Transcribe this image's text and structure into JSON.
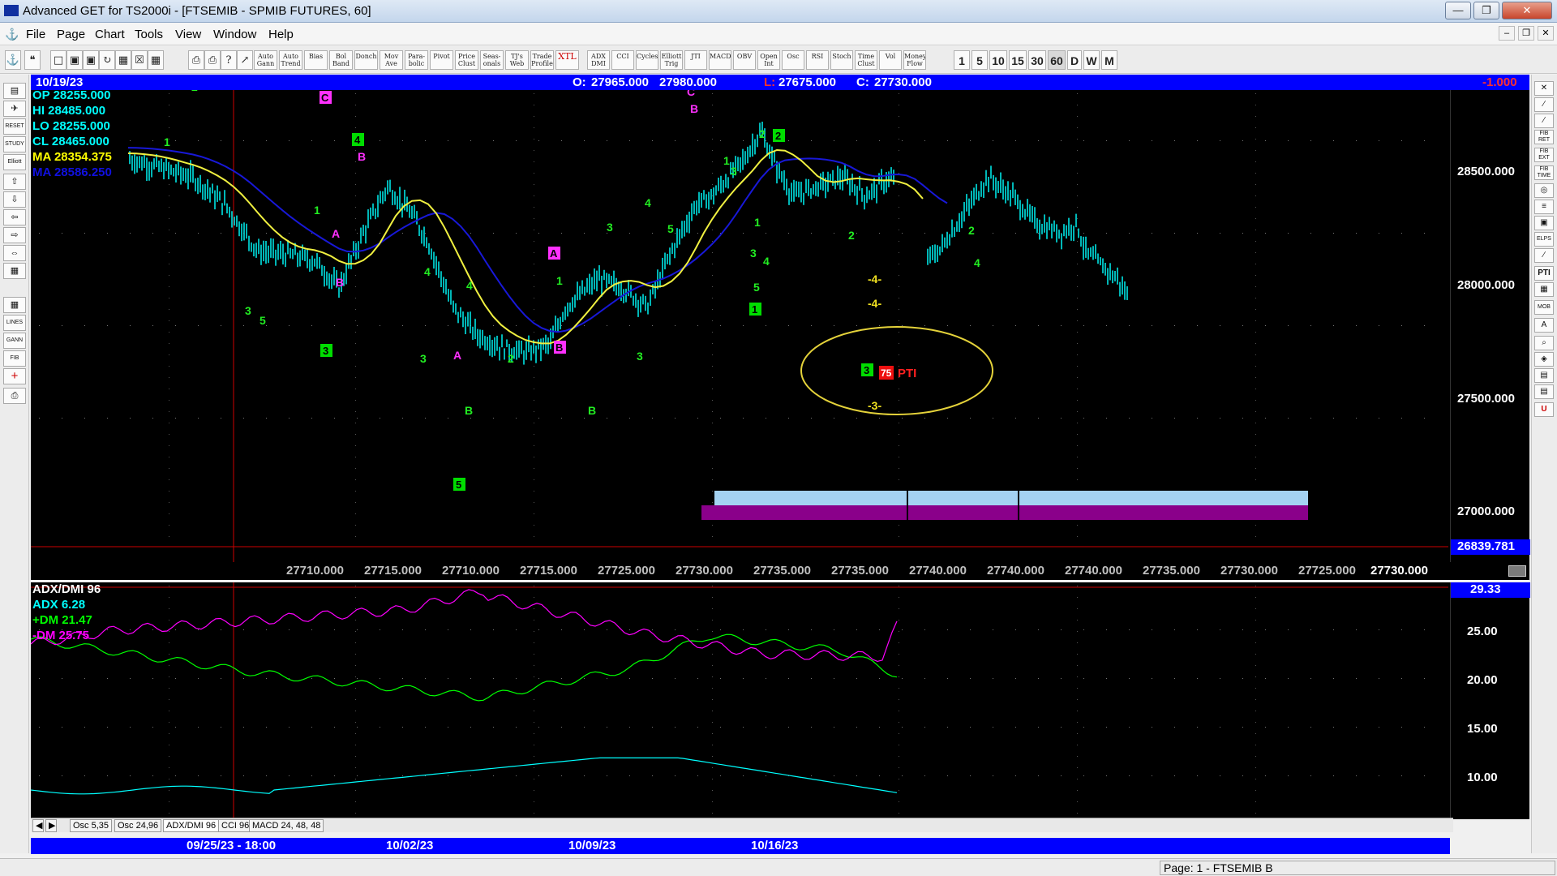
{
  "window": {
    "title": "Advanced GET for TS2000i - [FTSEMIB - SPMIB FUTURES, 60]",
    "min_glyph": "—",
    "max_glyph": "❐",
    "close_glyph": "✕"
  },
  "menu": {
    "items": [
      "File",
      "Page",
      "Chart",
      "Tools",
      "View",
      "Window",
      "Help"
    ],
    "mdi": [
      "–",
      "❐",
      "✕"
    ]
  },
  "toolbar": {
    "icons": [
      "⚓",
      "❝",
      "□",
      "▣",
      "▣",
      "↻",
      "▦",
      "☒",
      "▦",
      "⎙",
      "⎙",
      "?",
      "↗"
    ],
    "study_buttons": [
      "Auto Gann",
      "Auto Trend",
      "Bias",
      "Bol Band",
      "Donch",
      "Mov Ave",
      "Para-bolic",
      "Pivot",
      "Price Clust",
      "Seas-onals",
      "TJ's Web",
      "Trade Profile",
      "XTL",
      "ADX DMI",
      "CCI",
      "Cycles",
      "Elliott Trig",
      "JTI",
      "MACD",
      "OBV",
      "Open Int",
      "Osc",
      "RSI",
      "Stoch",
      "Time Clust",
      "Vol",
      "Money Flow"
    ],
    "periods": [
      "1",
      "5",
      "10",
      "15",
      "30",
      "60",
      "D",
      "W",
      "M"
    ],
    "active_period": "60"
  },
  "left_tools": [
    "▤",
    "✈",
    "RESET",
    "STUDY",
    "Elliott",
    "⇧",
    "⇩",
    "⇦",
    "⇨",
    "⇔",
    "▦",
    "▦",
    "LINES",
    "GANN",
    "FIB",
    "+",
    "⎙"
  ],
  "right_tools": [
    "✕",
    "∕",
    "∕",
    "FIB RET",
    "FIB EXT",
    "FIB TIME",
    "◎",
    "≡",
    "▣",
    "ELPS",
    "∕",
    "PTI",
    "▦",
    "MOB",
    "A",
    "⌕",
    "◈",
    "▤",
    "▤",
    "U"
  ],
  "chart_header": {
    "date": "10/19/23",
    "open_label": "O:",
    "open": "27965.000",
    "high": "27980.000",
    "low_label": "L:",
    "low": "27675.000",
    "close_label": "C:",
    "close": "27730.000",
    "change": "-1.000"
  },
  "legend": [
    {
      "text": "OP  28255.000",
      "color": "#00ffff"
    },
    {
      "text": "HI   28485.000",
      "color": "#00ffff"
    },
    {
      "text": "LO  28255.000",
      "color": "#00ffff"
    },
    {
      "text": "CL   28465.000",
      "color": "#00ffff"
    },
    {
      "text": "MA  28354.375",
      "color": "#ffff00"
    },
    {
      "text": "MA  28586.250",
      "color": "#1010e0"
    }
  ],
  "price_axis": {
    "labels": [
      "28500.000",
      "28000.000",
      "27500.000",
      "27000.000"
    ],
    "line_label": "26839.781"
  },
  "pivot_row": {
    "values": [
      "27710.000",
      "27715.000",
      "27710.000",
      "27715.000",
      "27725.000",
      "27730.000",
      "27735.000",
      "27735.000",
      "27740.000",
      "27740.000",
      "27740.000",
      "27735.000",
      "27730.000",
      "27725.000"
    ],
    "last": "27730.000"
  },
  "wave_labels": {
    "numbers": [
      "1",
      "2",
      "1",
      "4",
      "3",
      "5",
      "3",
      "4",
      "2",
      "1",
      "3",
      "4",
      "3",
      "5",
      "1",
      "2",
      "3",
      "4",
      "2",
      "1",
      "3",
      "5",
      "4",
      "2"
    ],
    "letters": [
      "A",
      "B",
      "B",
      "A",
      "B",
      "B",
      "C",
      "B"
    ],
    "boxed": [
      "4",
      "3",
      "5",
      "2",
      "1",
      "3"
    ],
    "pti_number": "75",
    "pti_text": "PTI",
    "forecast": [
      "-4-",
      "-4-",
      "-3-"
    ]
  },
  "indicator": {
    "title": "ADX/DMI 96",
    "adx": "ADX 6.28",
    "plus_dm": "+DM 21.47",
    "minus_dm": "-DM  25.75",
    "top_value": "29.33",
    "axis": [
      "25.00",
      "20.00",
      "15.00",
      "10.00"
    ],
    "colors": {
      "adx": "#00ffff",
      "plus": "#00ff00",
      "minus": "#ff00ff"
    }
  },
  "tabs": [
    "Osc 5,35",
    "Osc 24,96",
    "ADX/DMI 96",
    "CCI 96",
    "MACD 24, 48, 48"
  ],
  "active_tab": "ADX/DMI 96",
  "dates": [
    "09/25/23 - 18:00",
    "10/02/23",
    "10/09/23",
    "10/16/23"
  ],
  "status": "Page: 1 - FTSEMIB B"
}
